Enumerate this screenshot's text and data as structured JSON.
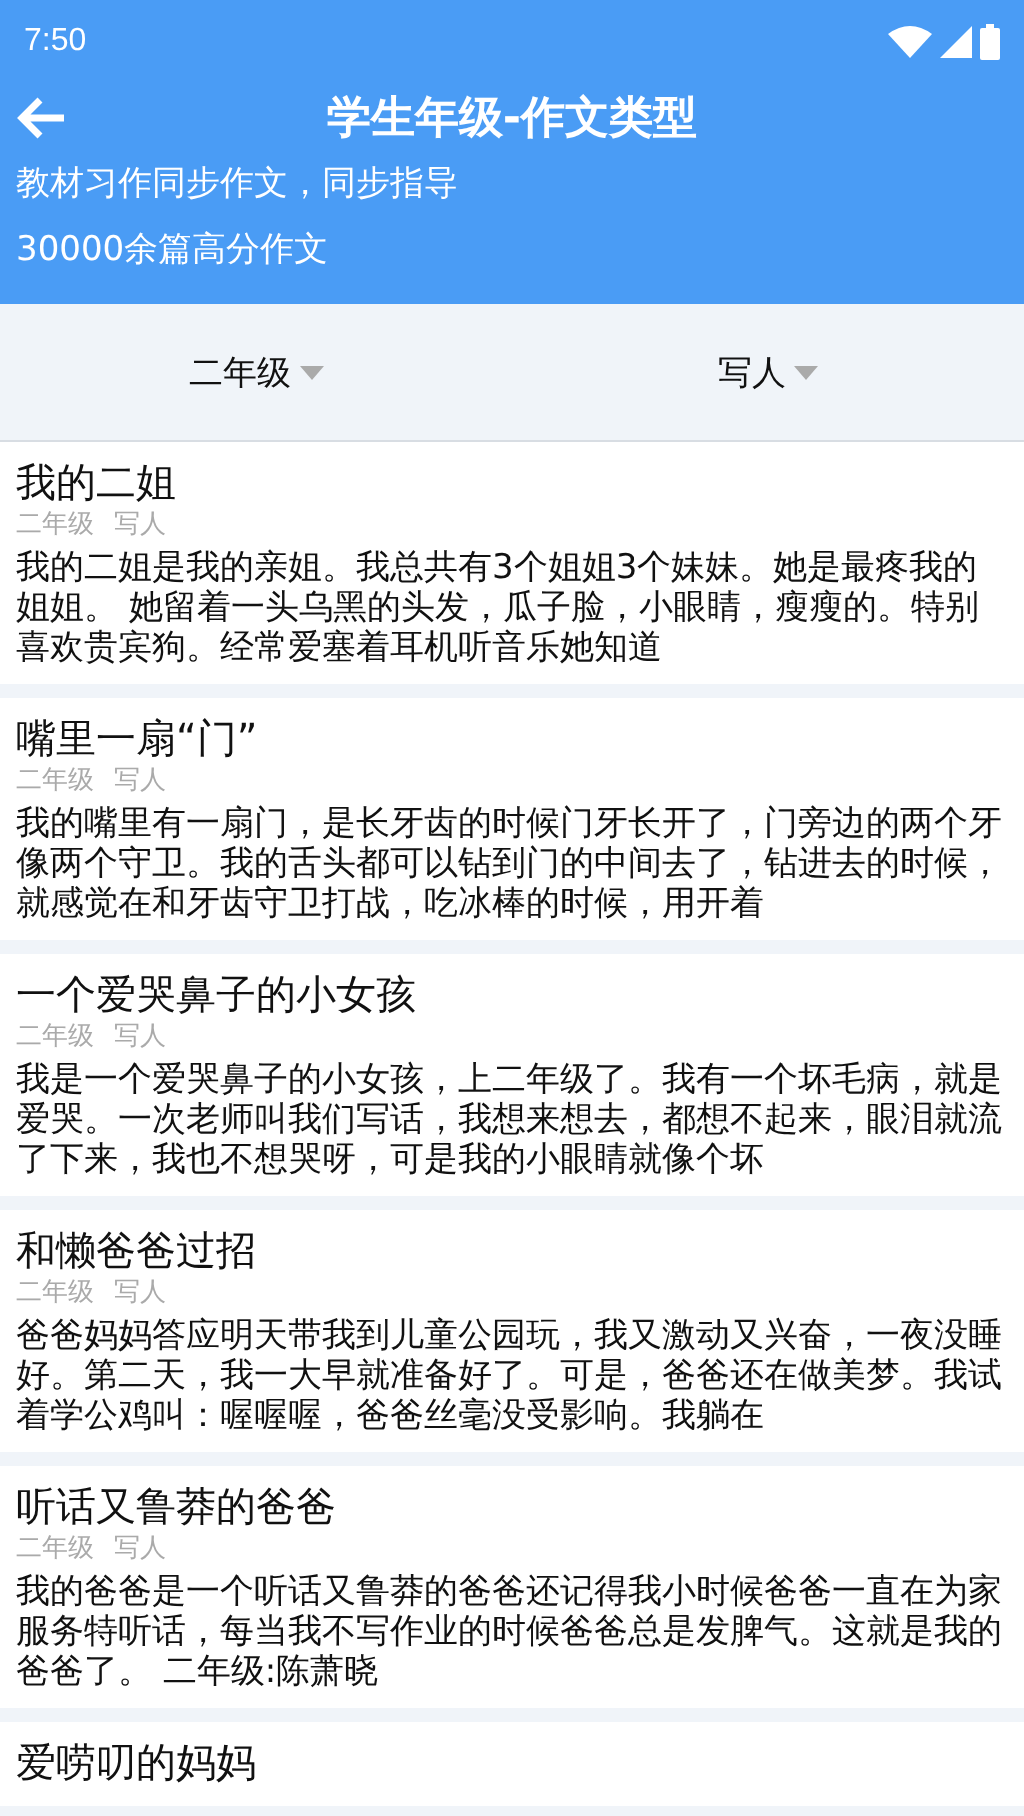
{
  "status_bar": {
    "time": "7:50"
  },
  "header": {
    "title": "学生年级-作文类型",
    "subtitle_lines": [
      "教材习作同步作文，同步指导",
      "30000余篇高分作文"
    ]
  },
  "filters": [
    {
      "label": "二年级"
    },
    {
      "label": "写人"
    }
  ],
  "essays": [
    {
      "title": "我的二姐",
      "grade": "二年级",
      "type": "写人",
      "excerpt": "我的二姐是我的亲姐。我总共有3个姐姐3个妹妹。她是最疼我的姐姐。 她留着一头乌黑的头发，瓜子脸，小眼睛，瘦瘦的。特别喜欢贵宾狗。经常爱塞着耳机听音乐她知道"
    },
    {
      "title": "嘴里一扇“门”",
      "grade": "二年级",
      "type": "写人",
      "excerpt": "我的嘴里有一扇门，是长牙齿的时候门牙长开了，门旁边的两个牙像两个守卫。我的舌头都可以钻到门的中间去了，钻进去的时候，就感觉在和牙齿守卫打战，吃冰棒的时候，用开着"
    },
    {
      "title": "一个爱哭鼻子的小女孩",
      "grade": "二年级",
      "type": "写人",
      "excerpt": "我是一个爱哭鼻子的小女孩，上二年级了。我有一个坏毛病，就是爱哭。一次老师叫我们写话，我想来想去，都想不起来，眼泪就流了下来，我也不想哭呀，可是我的小眼睛就像个坏"
    },
    {
      "title": "和懒爸爸过招",
      "grade": "二年级",
      "type": "写人",
      "excerpt": "爸爸妈妈答应明天带我到儿童公园玩，我又激动又兴奋，一夜没睡好。第二天，我一大早就准备好了。可是，爸爸还在做美梦。我试着学公鸡叫：喔喔喔，爸爸丝毫没受影响。我躺在"
    },
    {
      "title": "听话又鲁莽的爸爸",
      "grade": "二年级",
      "type": "写人",
      "excerpt": "我的爸爸是一个听话又鲁莽的爸爸还记得我小时候爸爸一直在为家服务特听话，每当我不写作业的时候爸爸总是发脾气。这就是我的爸爸了。 二年级:陈萧晓"
    },
    {
      "title": "爱唠叨的妈妈"
    }
  ]
}
